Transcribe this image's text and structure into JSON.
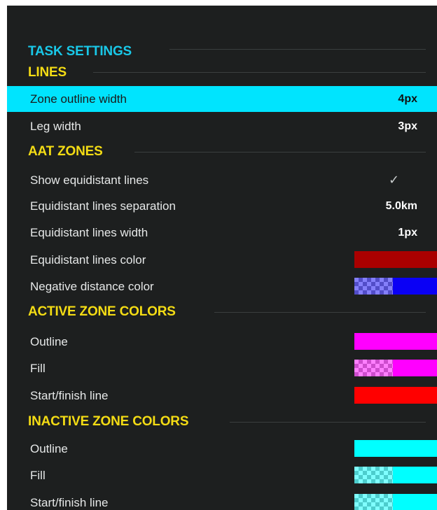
{
  "screen": {
    "title": "TASK SETTINGS",
    "sections": {
      "lines": "LINES",
      "aat_zones": "AAT ZONES",
      "active_zone_colors": "ACTIVE ZONE COLORS",
      "inactive_zone_colors": "INACTIVE ZONE COLORS"
    },
    "rows": {
      "zone_outline_width": {
        "label": "Zone outline width",
        "value": "4px",
        "selected": true
      },
      "leg_width": {
        "label": "Leg width",
        "value": "3px"
      },
      "show_equidistant_lines": {
        "label": "Show equidistant lines",
        "checked": true,
        "check_glyph": "✓"
      },
      "equidistant_lines_separation": {
        "label": "Equidistant lines separation",
        "value": "5.0km"
      },
      "equidistant_lines_width": {
        "label": "Equidistant lines width",
        "value": "1px"
      },
      "equidistant_lines_color": {
        "label": "Equidistant lines color",
        "color": "#aa0000"
      },
      "negative_distance_color": {
        "label": "Negative distance color",
        "color": "#0a00f5",
        "translucent_preview": true
      },
      "active_outline": {
        "label": "Outline",
        "color": "#ff00ff"
      },
      "active_fill": {
        "label": "Fill",
        "color": "#ff00ff",
        "translucent_preview": true
      },
      "active_start_finish_line": {
        "label": "Start/finish line",
        "color": "#ff0000"
      },
      "inactive_outline": {
        "label": "Outline",
        "color": "#00ffff"
      },
      "inactive_fill": {
        "label": "Fill",
        "color": "#00ffff",
        "translucent_preview": true
      },
      "inactive_start_finish_line": {
        "label": "Start/finish line",
        "color": "#00ffff",
        "translucent_preview": true
      }
    }
  },
  "colors": {
    "background": "#1d1f1f",
    "title": "#19c8e8",
    "section_header": "#f4dc14",
    "selection": "#00e4fe",
    "text": "#e6e8e8"
  }
}
